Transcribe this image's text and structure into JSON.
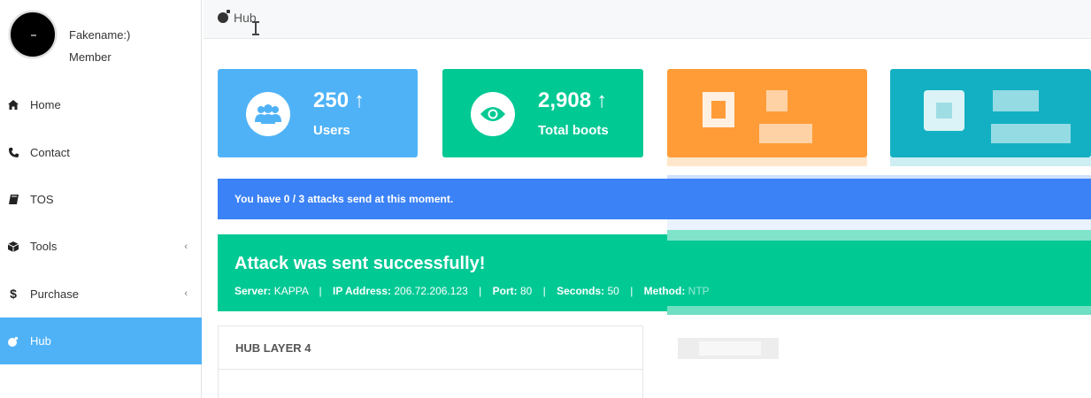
{
  "sidebar": {
    "user": {
      "name": "Fakename:)",
      "role": "Member"
    },
    "items": [
      {
        "label": "Home",
        "icon": "home-icon"
      },
      {
        "label": "Contact",
        "icon": "phone-icon"
      },
      {
        "label": "TOS",
        "icon": "book-icon"
      },
      {
        "label": "Tools",
        "icon": "cube-icon",
        "expandable": true
      },
      {
        "label": "Purchase",
        "icon": "dollar-icon",
        "expandable": true
      },
      {
        "label": "Hub",
        "icon": "bomb-icon",
        "active": true
      }
    ]
  },
  "header": {
    "title": "Hub"
  },
  "stats": [
    {
      "value": "250",
      "label": "Users",
      "color": "#4fb2f7",
      "icon": "users-icon"
    },
    {
      "value": "2,908",
      "label": "Total boots",
      "color": "#00c994",
      "icon": "eye-icon"
    },
    {
      "color": "#ff9c38"
    },
    {
      "color": "#13b0c3"
    }
  ],
  "attack_info": "You have 0 / 3 attacks send at this moment.",
  "success": {
    "title": "Attack was sent successfully!",
    "server_label": "Server:",
    "server": "KAPPA",
    "ip_label": "IP Address:",
    "ip": "206.72.206.123",
    "port_label": "Port:",
    "port": "80",
    "seconds_label": "Seconds:",
    "seconds": "50",
    "method_label": "Method:",
    "method": "NTP"
  },
  "panel": {
    "title": "HUB LAYER 4"
  },
  "colors": {
    "accent": "#4fb2f7",
    "success": "#00c994",
    "info": "#3b82f6"
  }
}
